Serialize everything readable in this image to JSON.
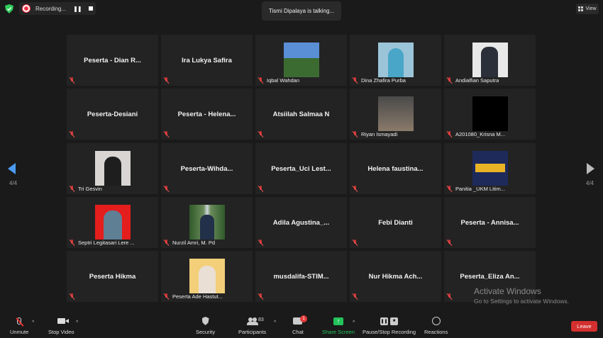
{
  "topbar": {
    "recording_label": "Recording...",
    "talking": "Tismi Dipalaya is talking...",
    "view_label": "View"
  },
  "navigation": {
    "page_left": "4/4",
    "page_right": "4/4"
  },
  "tiles": [
    {
      "name": "Peserta - Dian R...",
      "label": "",
      "photo": "none"
    },
    {
      "name": "Ira Lukya Safira",
      "label": "",
      "photo": "none"
    },
    {
      "name": "",
      "label": "Iqbal Wahdan",
      "photo": "landscape"
    },
    {
      "name": "",
      "label": "Dina Zhafira Purba",
      "photo": "hijab-blue"
    },
    {
      "name": "",
      "label": "Andialfian Saputra",
      "photo": "man-white"
    },
    {
      "name": "Peserta-Desiani",
      "label": "",
      "photo": "none"
    },
    {
      "name": "Peserta - Helena...",
      "label": "",
      "photo": "none"
    },
    {
      "name": "Atsiilah Salmaa N",
      "label": "",
      "photo": "none"
    },
    {
      "name": "",
      "label": "Riyan Ismayadi",
      "photo": "street"
    },
    {
      "name": "",
      "label": "A201080_Krisna M...",
      "photo": "black"
    },
    {
      "name": "",
      "label": "Tri Gesvin",
      "photo": "hijab-white"
    },
    {
      "name": "Peserta-Wihda...",
      "label": "",
      "photo": "none"
    },
    {
      "name": "Peserta_Uci Lest...",
      "label": "",
      "photo": "none"
    },
    {
      "name": "Helena faustina...",
      "label": "",
      "photo": "none"
    },
    {
      "name": "",
      "label": "Panitia _UKM Litim...",
      "photo": "banner"
    },
    {
      "name": "",
      "label": "Septri Legitasari Lere ...",
      "photo": "red"
    },
    {
      "name": "",
      "label": "Nurzil Amri, M. Pd",
      "photo": "waterfall"
    },
    {
      "name": "Adila Agustina_...",
      "label": "",
      "photo": "none"
    },
    {
      "name": "Febi Dianti",
      "label": "",
      "photo": "none"
    },
    {
      "name": "Peserta - Annisa...",
      "label": "",
      "photo": "none"
    },
    {
      "name": "Peserta Hikma",
      "label": "",
      "photo": "none"
    },
    {
      "name": "",
      "label": "Peserta Ade Hastut...",
      "photo": "yellow"
    },
    {
      "name": "musdalifa-STIM...",
      "label": "",
      "photo": "none"
    },
    {
      "name": "Nur Hikma Ach...",
      "label": "",
      "photo": "none"
    },
    {
      "name": "Peserta_Eliza An...",
      "label": "",
      "photo": "none"
    }
  ],
  "watermark": {
    "line1": "Activate Windows",
    "line2": "Go to Settings to activate Windows."
  },
  "toolbar": {
    "unmute": "Unmute",
    "stop_video": "Stop Video",
    "security": "Security",
    "participants": "Participants",
    "participant_count": "83",
    "chat": "Chat",
    "chat_badge": "1",
    "share_screen": "Share Screen",
    "pause_stop_recording": "Pause/Stop Recording",
    "reactions": "Reactions",
    "leave": "Leave"
  },
  "colors": {
    "share_green": "#23c35b",
    "leave_red": "#d3302f",
    "nav_blue": "#4b9cf0"
  }
}
